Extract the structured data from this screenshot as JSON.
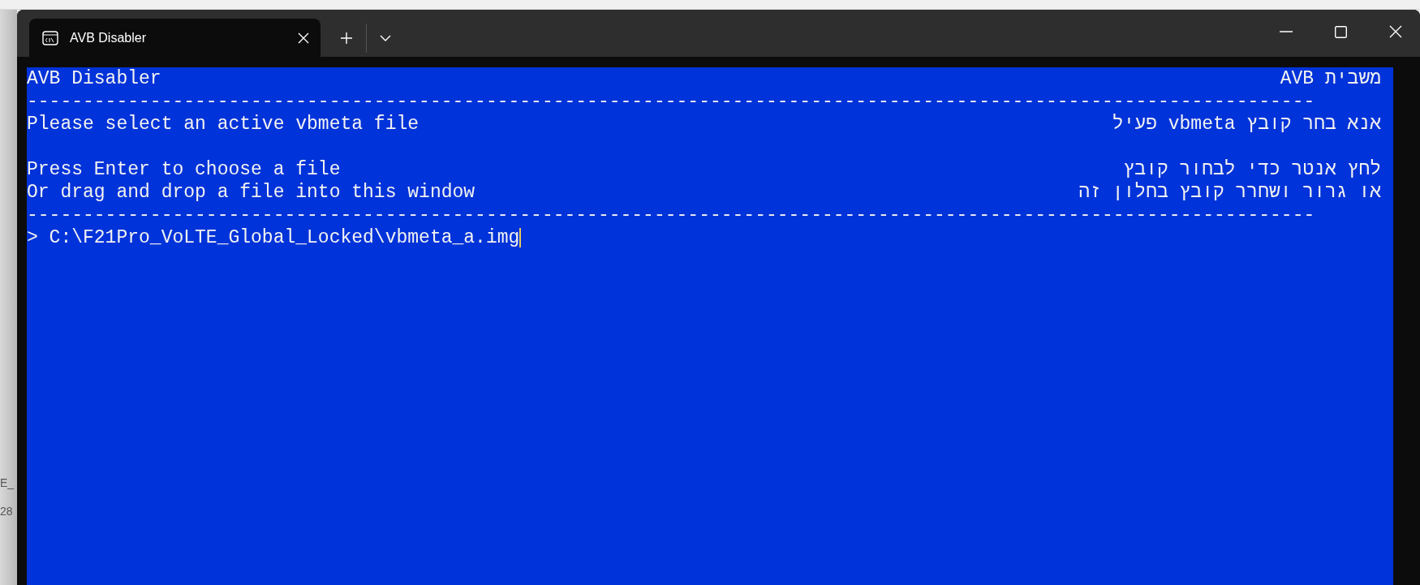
{
  "background": {
    "fragments": [
      "E_",
      "28"
    ]
  },
  "window": {
    "tabs": [
      {
        "title": "AVB Disabler",
        "selected": true
      }
    ]
  },
  "terminal": {
    "lines": [
      {
        "kind": "text",
        "left": "AVB Disabler",
        "right": "משבית AVB"
      },
      {
        "kind": "rule",
        "left": "-------------------------------------------------------------------------------------------------------------------"
      },
      {
        "kind": "text",
        "left": "Please select an active vbmeta file",
        "right": "אנא בחר קובץ vbmeta פעיל"
      },
      {
        "kind": "blank"
      },
      {
        "kind": "text",
        "left": "Press Enter to choose a file",
        "right": "לחץ אנטר כדי לבחור קובץ"
      },
      {
        "kind": "text",
        "left": "Or drag and drop a file into this window",
        "right": "או גרור ושחרר קובץ בחלון זה"
      },
      {
        "kind": "rule",
        "left": "-------------------------------------------------------------------------------------------------------------------"
      },
      {
        "kind": "prompt",
        "left": "> C:\\F21Pro_VoLTE_Global_Locked\\vbmeta_a.img",
        "cursor": true
      }
    ]
  }
}
